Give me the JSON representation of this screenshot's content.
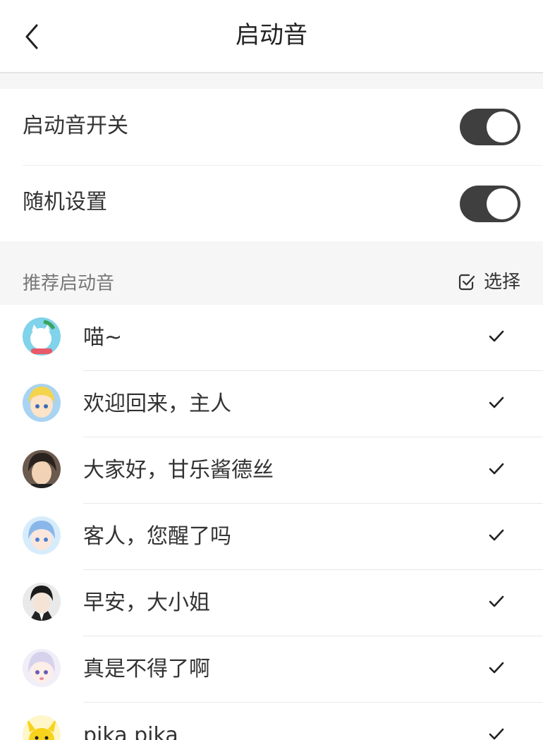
{
  "header": {
    "title": "启动音",
    "back_icon": "chevron-left-icon"
  },
  "settings": [
    {
      "label": "启动音开关",
      "enabled": true
    },
    {
      "label": "随机设置",
      "enabled": true
    }
  ],
  "section": {
    "title": "推荐启动音",
    "select_label": "选择",
    "select_icon": "checkbox-icon"
  },
  "sounds": [
    {
      "label": "喵~",
      "checked": true
    },
    {
      "label": "欢迎回来，主人",
      "checked": true
    },
    {
      "label": "大家好，甘乐酱德丝",
      "checked": true
    },
    {
      "label": "客人，您醒了吗",
      "checked": true
    },
    {
      "label": "早安，大小姐",
      "checked": true
    },
    {
      "label": "真是不得了啊",
      "checked": true
    },
    {
      "label": "pika pika",
      "checked": true
    }
  ],
  "colors": {
    "toggle_on": "#3f3f3f",
    "background": "#f6f6f6",
    "text": "#333333"
  }
}
